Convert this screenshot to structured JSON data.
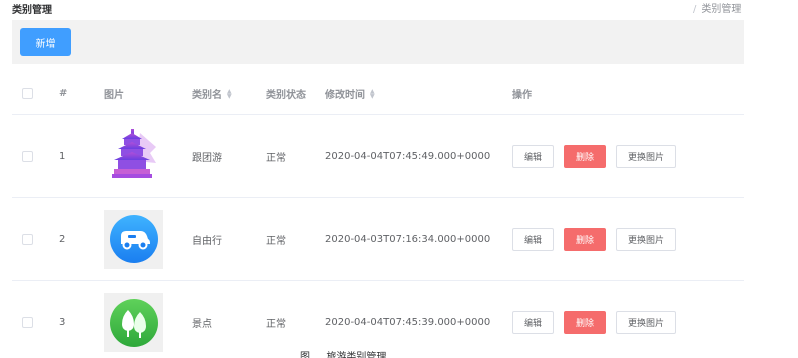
{
  "header": {
    "title": "类别管理",
    "breadcrumb_sep": "/",
    "breadcrumb_current": "类别管理"
  },
  "toolbar": {
    "add_label": "新增"
  },
  "table": {
    "columns": {
      "index": "#",
      "image": "图片",
      "name": "类别名",
      "status": "类别状态",
      "modified": "修改时间",
      "ops": "操作"
    },
    "rows": [
      {
        "index": "1",
        "name": "跟团游",
        "status": "正常",
        "modified": "2020-04-04T07:45:49.000+0000",
        "icon": "temple-icon"
      },
      {
        "index": "2",
        "name": "自由行",
        "status": "正常",
        "modified": "2020-04-03T07:16:34.000+0000",
        "icon": "car-icon"
      },
      {
        "index": "3",
        "name": "景点",
        "status": "正常",
        "modified": "2020-04-04T07:45:39.000+0000",
        "icon": "trees-icon"
      }
    ],
    "actions": {
      "edit": "编辑",
      "delete": "删除",
      "change_image": "更换图片"
    }
  },
  "colors": {
    "primary": "#409eff",
    "danger": "#f56c6c",
    "toolbar_bg": "#f2f2f2"
  },
  "caption": "图 … 旅游类别管理"
}
